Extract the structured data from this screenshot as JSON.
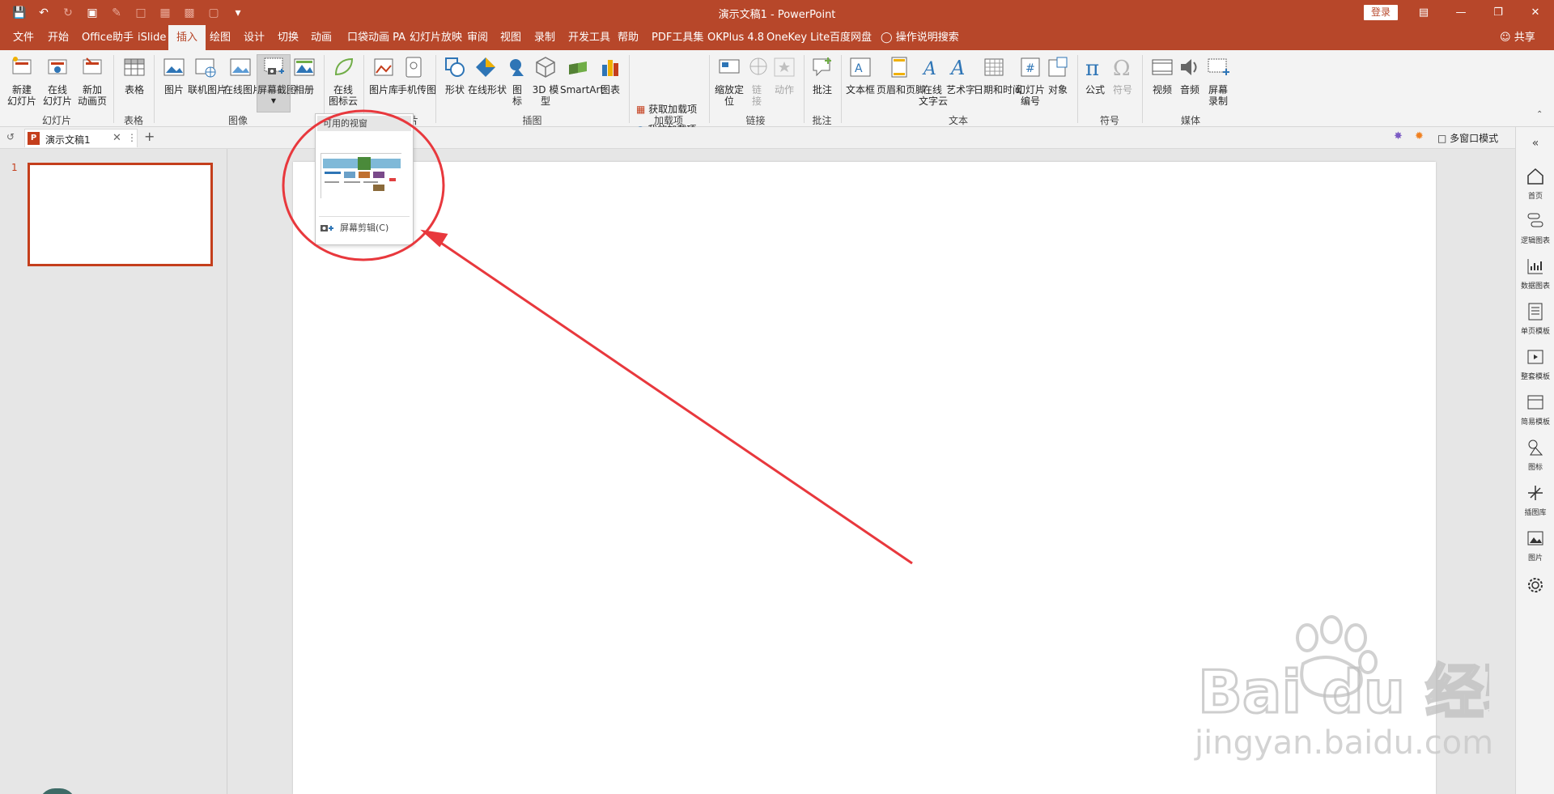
{
  "titlebar": {
    "title": "演示文稿1  -  PowerPoint",
    "login": "登录"
  },
  "menu_tabs": [
    "文件",
    "开始",
    "Office助手",
    "iSlide",
    "插入",
    "绘图",
    "设计",
    "切换",
    "动画",
    "口袋动画 PA",
    "幻灯片放映",
    "审阅",
    "视图",
    "录制",
    "开发工具",
    "帮助",
    "PDF工具集",
    "OKPlus 4.8",
    "OneKey Lite",
    "百度网盘",
    "操作说明搜索"
  ],
  "share_label": "共享",
  "ribbon": {
    "new_slide": "新建\n幻灯片",
    "online_slide": "在线\n幻灯片",
    "new_anim_page": "新加\n动画页",
    "table": "表格",
    "picture": "图片",
    "online_pic": "联机图片",
    "online_pic2": "在线图片",
    "screenshot": "屏幕截图",
    "album": "相册",
    "online_icon_cloud": "在线\n图标云",
    "pic_library": "图片库",
    "phone_pic": "手机传图",
    "shapes": "形状",
    "online_shapes": "在线形状",
    "icons": "图\n标",
    "model3d": "3D 模\n型",
    "smartart": "SmartArt",
    "chart": "图表",
    "get_addins": "获取加载项",
    "my_addins": "我的加载项",
    "zoom": "缩放定\n位",
    "link": "链\n接",
    "action": "动作",
    "comment": "批注",
    "textbox": "文本框",
    "header_footer": "页眉和页脚",
    "online_text_cloud": "在线\n文字云",
    "wordart": "艺术字",
    "datetime": "日期和时间",
    "slide_number": "幻灯片\n编号",
    "object": "对象",
    "equation": "公式",
    "symbol": "符号",
    "video": "视频",
    "audio": "音频",
    "screen_record": "屏幕\n录制",
    "groups": {
      "slides": "幻灯片",
      "tables": "表格",
      "images": "图像",
      "online_pics": "在线图片",
      "illustrations": "插图",
      "addins": "加载项",
      "links": "链接",
      "comments": "批注",
      "text": "文本",
      "symbols": "符号",
      "media": "媒体"
    }
  },
  "doc_tab": {
    "name": "演示文稿1"
  },
  "multi_window": "多窗口模式",
  "slide_number": "1",
  "dropdown": {
    "header": "可用的视窗",
    "clip": "屏幕剪辑(C)"
  },
  "side_bar": [
    "首页",
    "逻辑图表",
    "数据图表",
    "单页模板",
    "整套模板",
    "简易模板",
    "图标",
    "插图库",
    "图片"
  ],
  "watermark": "jingyan.baidu.com",
  "colors": {
    "accent": "#b7472a",
    "annotation": "#e8383d"
  }
}
